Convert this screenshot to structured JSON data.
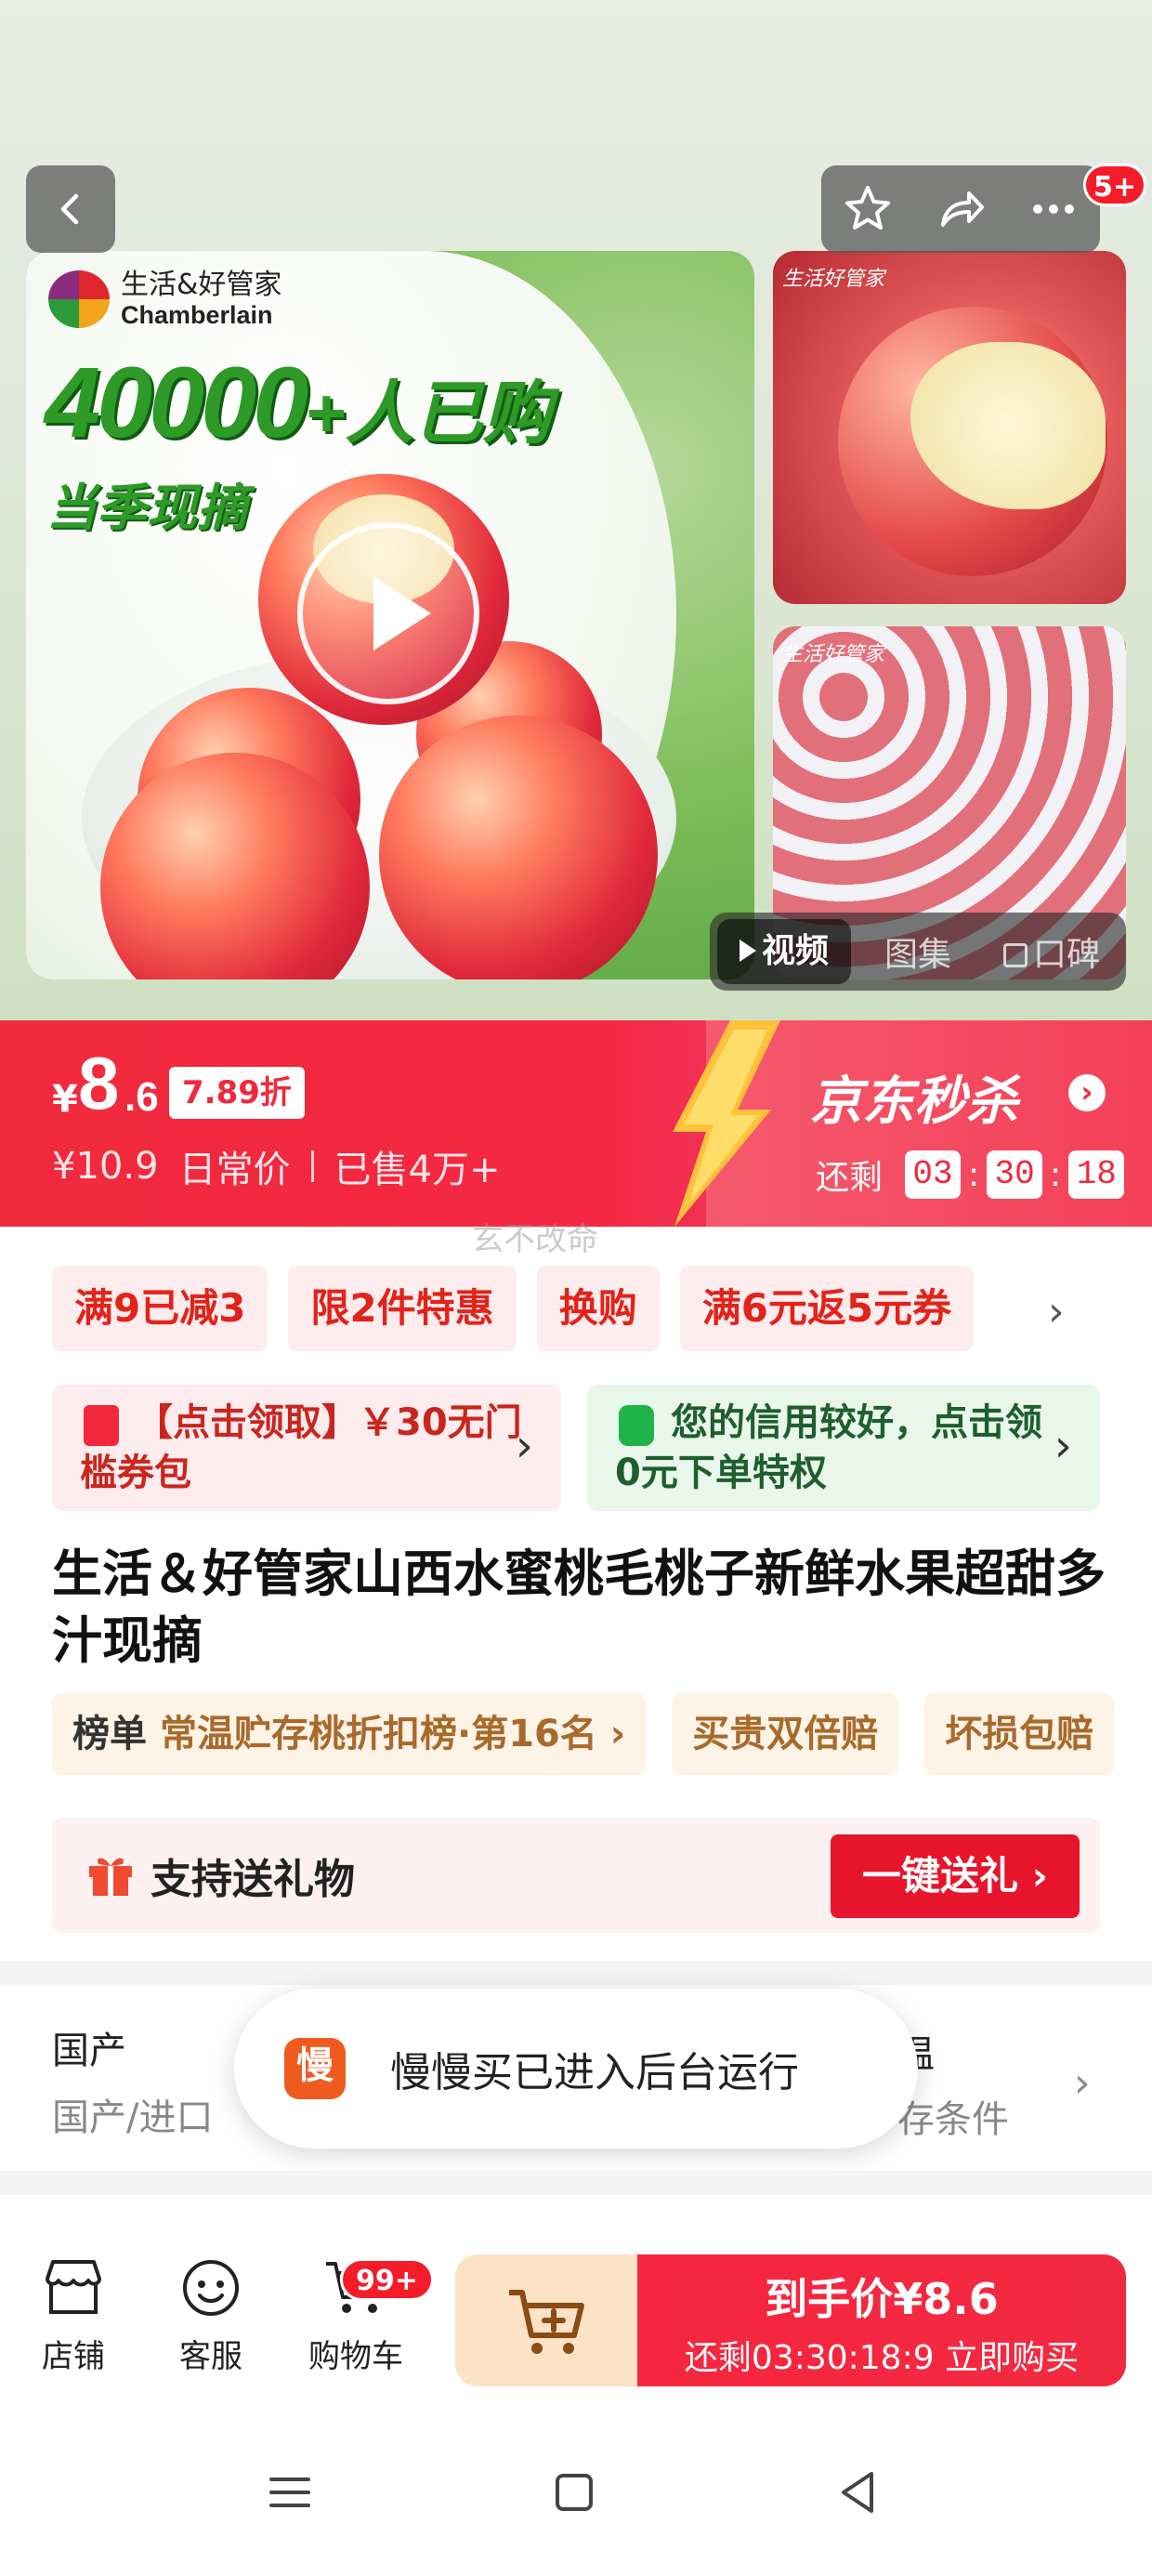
{
  "gallery": {
    "brand_cn": "生活&好管家",
    "brand_en": "Chamberlain",
    "sold_count": "40000",
    "sold_suffix": "+人已购",
    "subline": "当季现摘",
    "thumb1_brand": "生活好管家",
    "thumb2_brand": "生活好管家",
    "media_tabs": [
      "视频",
      "图集",
      "口碑"
    ],
    "active_tab": "视频",
    "notification_badge": "5+",
    "icons": [
      "back-icon",
      "star-icon",
      "share-icon",
      "more-icon",
      "play-icon"
    ]
  },
  "price": {
    "currency": "¥",
    "integer": "8",
    "decimal": ".6",
    "discount": "7.89折",
    "original": "¥10.9",
    "original_label": "日常价",
    "sold": "已售4万+",
    "flash_title": "京东秒杀",
    "countdown_label": "还剩",
    "countdown": [
      "03",
      "30",
      "18"
    ],
    "watermark": "玄不改命"
  },
  "promos": {
    "chips": [
      "满9已减3",
      "限2件特惠",
      "换购",
      "满6元返5元券"
    ],
    "coupon_red": "【点击领取】￥30无门槛券包",
    "coupon_green": "您的信用较好，点击领0元下单特权"
  },
  "product": {
    "title": "生活＆好管家山西水蜜桃毛桃子新鲜水果超甜多汁现摘",
    "rank_label": "榜单",
    "rank_text": "常温贮存桃折扣榜·第16名 ›",
    "tag2": "买贵双倍赔",
    "tag3": "坏损包赔"
  },
  "gift": {
    "text": "支持送礼物",
    "button": "一键送礼 ›"
  },
  "specs": {
    "label1": "国产",
    "value1": "国产/进口",
    "label2": "温",
    "value2": "存条件"
  },
  "toast": {
    "icon_text": "慢",
    "message": "慢慢买已进入后台运行"
  },
  "bottom_bar": {
    "shop": "店铺",
    "service": "客服",
    "cart": "购物车",
    "cart_badge": "99+",
    "buy_main": "到手价¥8.6",
    "buy_sub": "还剩03:30:18:9 立即购买"
  },
  "colors": {
    "accent_red": "#f1283c",
    "green": "#2e9a27",
    "coupon_green": "#1fb34a",
    "gold": "#a86a2b"
  }
}
